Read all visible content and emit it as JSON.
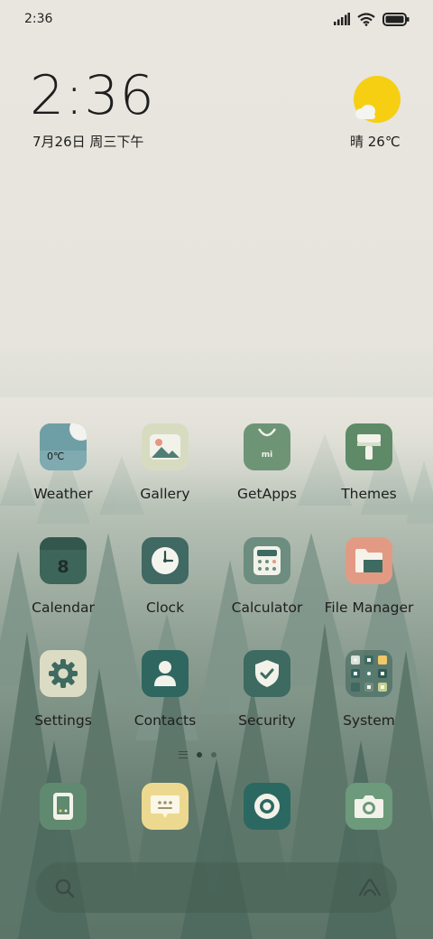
{
  "status_bar": {
    "time": "2:36",
    "icons": [
      "signal-icon",
      "wifi-icon",
      "battery-icon"
    ]
  },
  "clock_widget": {
    "time": "2:36",
    "date": "7月26日 周三下午"
  },
  "weather_widget": {
    "icon": "sun-cloud-icon",
    "text": "晴 26℃"
  },
  "apps": [
    {
      "label": "Weather",
      "icon": "weather-icon",
      "badge_text": "0℃",
      "color": "#6f9fa6"
    },
    {
      "label": "Gallery",
      "icon": "gallery-icon",
      "color": "#d7dcc1"
    },
    {
      "label": "GetApps",
      "icon": "getapps-icon",
      "badge_text": "mi",
      "color": "#6e9476"
    },
    {
      "label": "Themes",
      "icon": "themes-icon",
      "color": "#5f8a67"
    },
    {
      "label": "Calendar",
      "icon": "calendar-icon",
      "badge_text": "8",
      "color": "#3e655a"
    },
    {
      "label": "Clock",
      "icon": "clock-icon",
      "color": "#3f6962"
    },
    {
      "label": "Calculator",
      "icon": "calculator-icon",
      "color": "#6c8d80"
    },
    {
      "label": "File Manager",
      "icon": "folder-icon",
      "color": "#e39a84"
    },
    {
      "label": "Settings",
      "icon": "settings-icon",
      "color": "#dcdcc4"
    },
    {
      "label": "Contacts",
      "icon": "contacts-icon",
      "color": "#2f6660"
    },
    {
      "label": "Security",
      "icon": "security-icon",
      "color": "#3d6a61"
    },
    {
      "label": "System",
      "icon": "system-folder-icon",
      "color": "#3a6058"
    }
  ],
  "dock": [
    {
      "icon": "phone-icon",
      "color": "#5f8a70"
    },
    {
      "icon": "messaging-icon",
      "color": "#ecd98f"
    },
    {
      "icon": "browser-icon",
      "color": "#2c6862"
    },
    {
      "icon": "camera-icon",
      "color": "#6c9a7b"
    }
  ],
  "pager": {
    "active_page": 1,
    "page_count": 2
  },
  "search_bar": {
    "icons": [
      "search-icon",
      "assistant-icon"
    ]
  }
}
